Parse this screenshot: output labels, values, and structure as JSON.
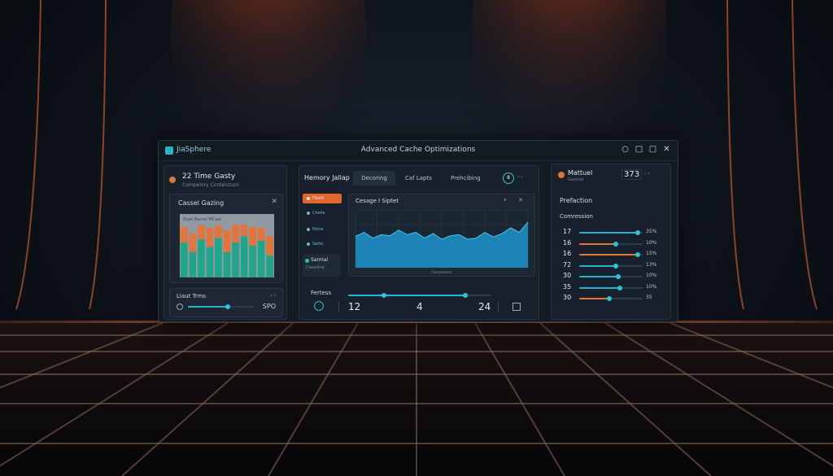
{
  "window": {
    "app_name": "JiaSphere",
    "title": "Advanced Cache Optimizations",
    "controls": [
      "○",
      "□",
      "□",
      "✕"
    ]
  },
  "left_panel": {
    "title": "22 Time Gasty",
    "subtitle": "Compelory Contenzuon",
    "cache_card": {
      "title": "Cassel Gazing",
      "close": "✕",
      "chart_caption": "Sipel   Barnal   MCaal"
    },
    "limit_card": {
      "label": "Liaut Trms",
      "more": "‹ ›",
      "value": "SPO",
      "slider_level": 0.6
    }
  },
  "middle_panel": {
    "tabs": [
      "Hemory Jallap",
      "Decoring",
      "Caf Lapts",
      "Prehcibing"
    ],
    "badge": "8",
    "arrows": "‹ ›",
    "side_items": [
      {
        "label": "Fbeth",
        "active": true
      },
      {
        "label": "Chelie",
        "active": false
      },
      {
        "label": "Eetra",
        "active": false
      },
      {
        "label": "Sette",
        "active": false
      }
    ],
    "side_card": {
      "title": "Sarmal",
      "subtitle": "Claseline"
    },
    "usage_card": {
      "title": "Cesage I Siptet",
      "icons": "• ✕",
      "x_caption": "Cooplesten"
    },
    "factors_label": "Fertess",
    "factor_slider": {
      "knob_a": 0.25,
      "knob_b": 0.82
    },
    "bottom_values": [
      "12",
      "4",
      "24"
    ]
  },
  "right_panel": {
    "title": "Mattuel",
    "subtitle": "Gavmal",
    "number": "373",
    "arrows": "‹ ›",
    "heading": "Prefaction",
    "subheading": "Comression",
    "rows": [
      {
        "label": "17",
        "value": "35%",
        "level": 0.92,
        "color": "teal"
      },
      {
        "label": "16",
        "value": "10%",
        "level": 0.58,
        "color": "orange"
      },
      {
        "label": "16",
        "value": "15%",
        "level": 0.92,
        "color": "orange"
      },
      {
        "label": "72",
        "value": "13%",
        "level": 0.58,
        "color": "teal"
      },
      {
        "label": "30",
        "value": "10%",
        "level": 0.62,
        "color": "teal"
      },
      {
        "label": "35",
        "value": "10%",
        "level": 0.64,
        "color": "teal"
      },
      {
        "label": "30",
        "value": "35",
        "level": 0.48,
        "color": "orange"
      }
    ]
  },
  "colors": {
    "accent_teal": "#23b4d0",
    "accent_orange": "#e4743a",
    "bg": "#121a22"
  },
  "chart_data": [
    {
      "type": "bar",
      "categories": [
        "1",
        "2",
        "3",
        "4",
        "5",
        "6",
        "7",
        "8",
        "9",
        "10",
        "11"
      ],
      "series": [
        {
          "values": [
            55,
            40,
            60,
            48,
            62,
            40,
            55,
            65,
            50,
            58,
            35
          ]
        },
        {
          "values": [
            25,
            30,
            22,
            30,
            20,
            35,
            28,
            18,
            30,
            20,
            30
          ]
        }
      ],
      "ylim": [
        0,
        100
      ]
    },
    {
      "type": "area",
      "x": [
        0,
        1,
        2,
        3,
        4,
        5,
        6,
        7,
        8,
        9,
        10,
        11,
        12,
        13,
        14,
        15,
        16,
        17,
        18,
        19,
        20
      ],
      "values": [
        55,
        62,
        52,
        58,
        56,
        66,
        58,
        62,
        52,
        60,
        50,
        56,
        58,
        50,
        52,
        62,
        54,
        60,
        70,
        62,
        80
      ],
      "ylim": [
        0,
        100
      ],
      "grid": true
    }
  ]
}
